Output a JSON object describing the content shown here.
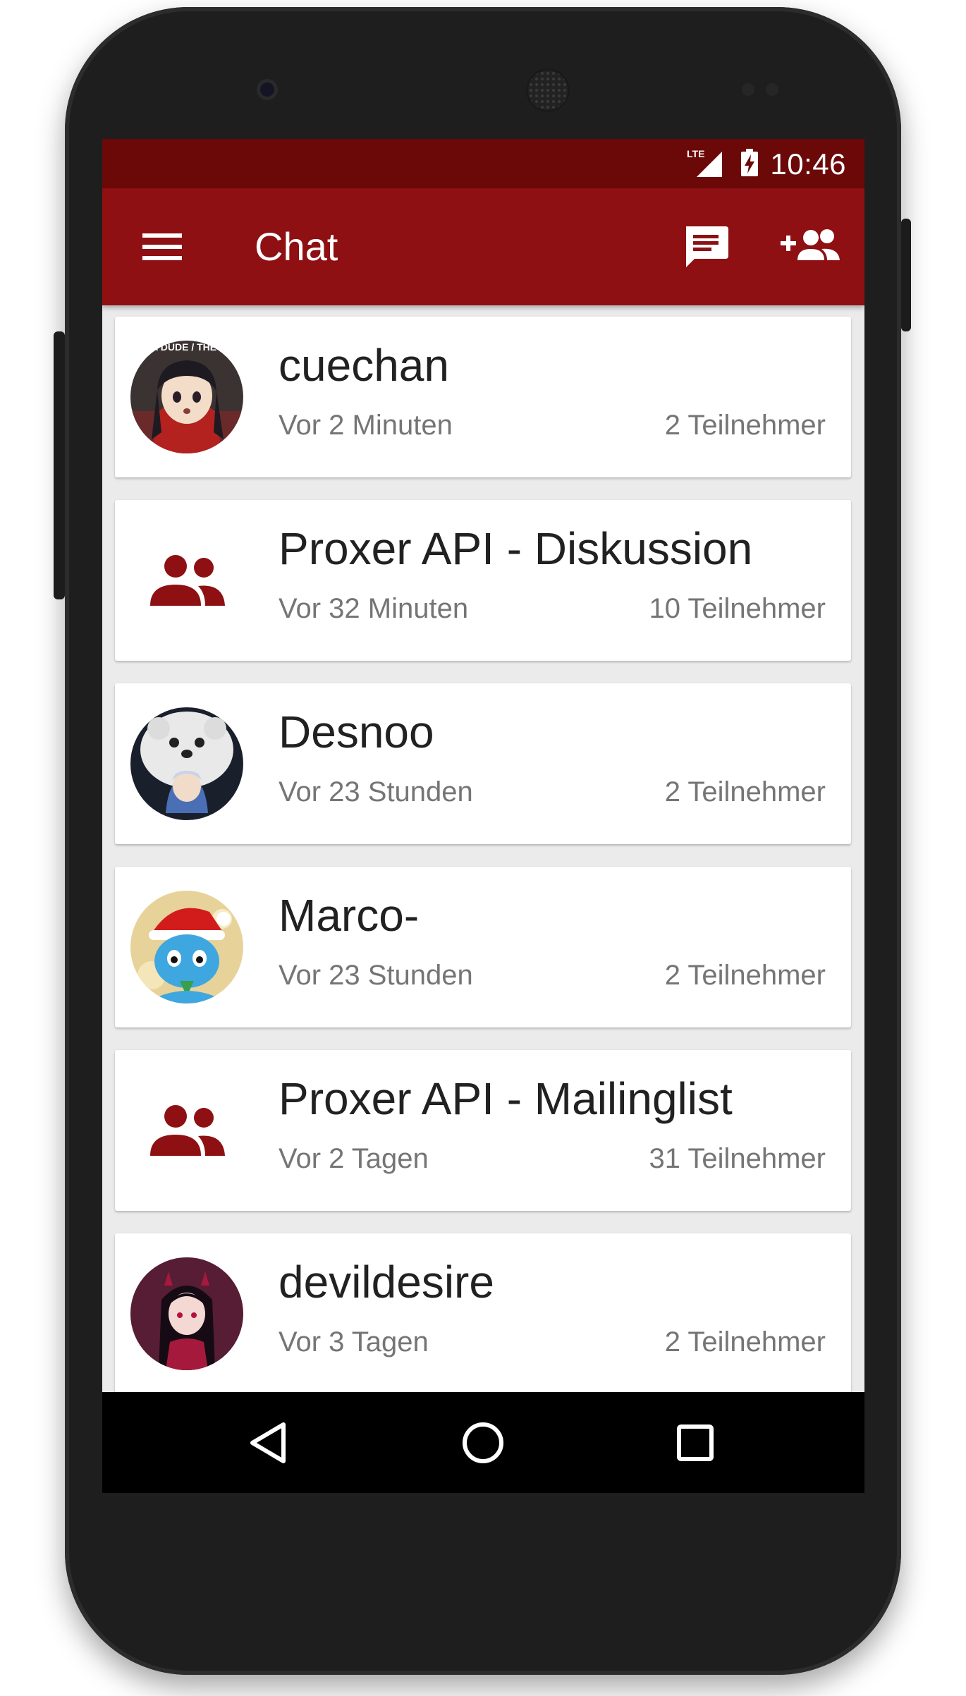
{
  "status_bar": {
    "network": "LTE",
    "time": "10:46"
  },
  "toolbar": {
    "title": "Chat",
    "menu_icon": "menu-icon",
    "new_chat_icon": "message-icon",
    "add_user_icon": "person-add-icon"
  },
  "colors": {
    "primary": "#8e1013",
    "primary_dark": "#6b0808",
    "accent_icon": "#8e1013",
    "background": "#ebebeb",
    "card": "#ffffff",
    "text_primary": "#212121",
    "text_secondary": "#757575"
  },
  "chats": [
    {
      "name": "cuechan",
      "time": "Vor 2 Minuten",
      "members": "2 Teilnehmer",
      "type": "user",
      "avatar_text": "WHOA DUDE / THE FUCK"
    },
    {
      "name": "Proxer API - Diskussion",
      "time": "Vor 32 Minuten",
      "members": "10 Teilnehmer",
      "type": "group"
    },
    {
      "name": "Desnoo",
      "time": "Vor 23 Stunden",
      "members": "2 Teilnehmer",
      "type": "user"
    },
    {
      "name": "Marco-",
      "time": "Vor 23 Stunden",
      "members": "2 Teilnehmer",
      "type": "user"
    },
    {
      "name": "Proxer API - Mailinglist",
      "time": "Vor 2 Tagen",
      "members": "31 Teilnehmer",
      "type": "group"
    },
    {
      "name": "devildesire",
      "time": "Vor 3 Tagen",
      "members": "2 Teilnehmer",
      "type": "user"
    }
  ],
  "nav_bar": {
    "back_icon": "back-icon",
    "home_icon": "home-icon",
    "recents_icon": "recents-icon"
  }
}
